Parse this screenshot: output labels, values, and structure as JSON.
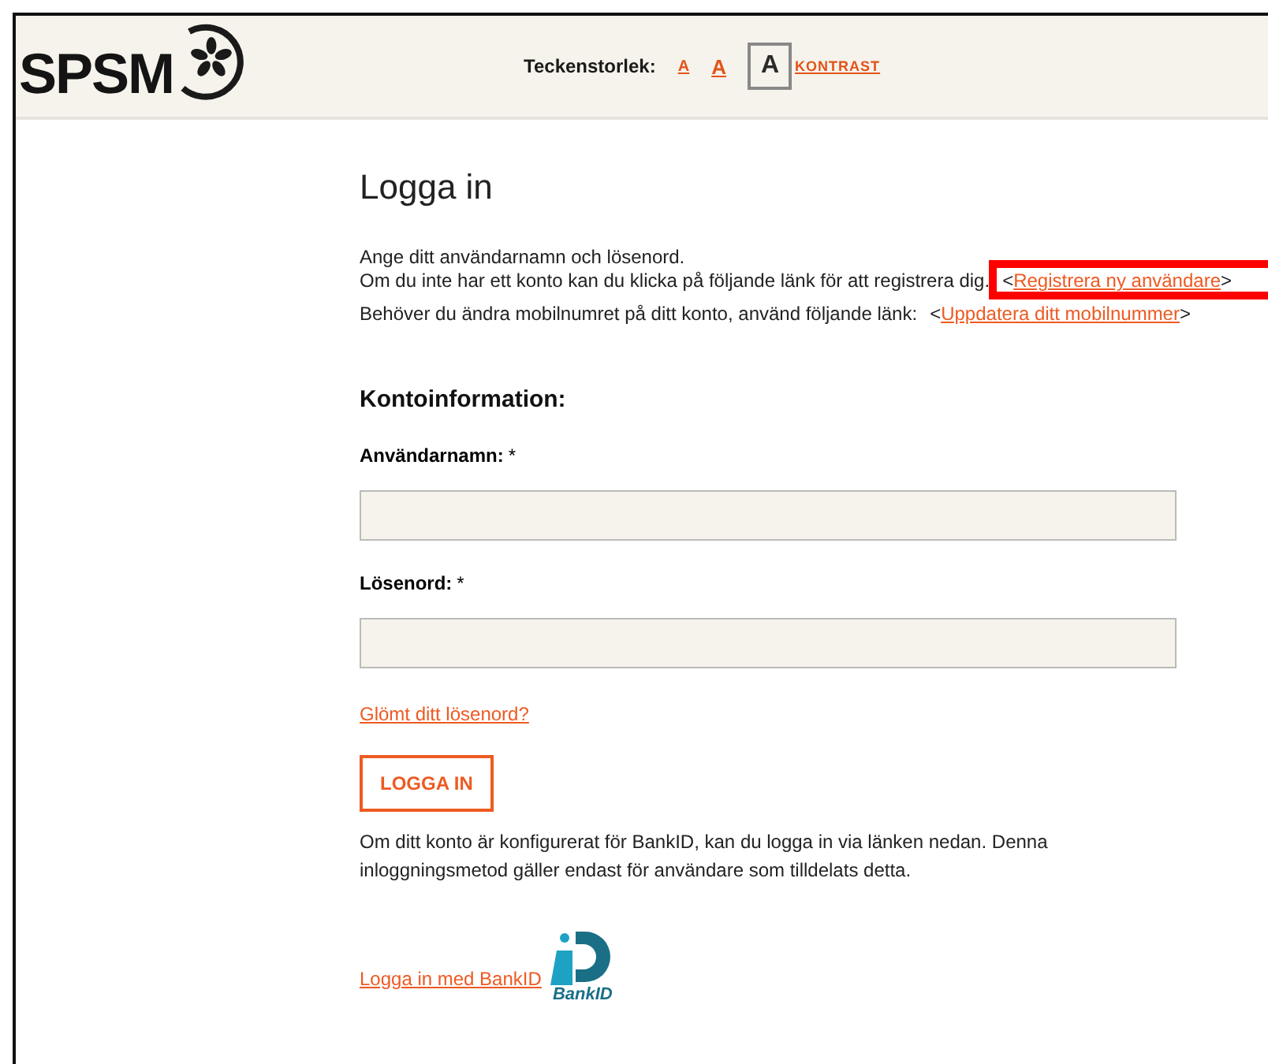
{
  "header": {
    "logo": "SPSM",
    "font_size_label": "Teckenstorlek:",
    "font_sizes": [
      {
        "label": "A",
        "kind": "small",
        "selected": false
      },
      {
        "label": "A",
        "kind": "medium",
        "selected": false
      },
      {
        "label": "A",
        "kind": "large",
        "selected": true
      }
    ],
    "contrast": "KONTRAST"
  },
  "title": "Logga in",
  "intro": [
    {
      "text": "Ange ditt användarnamn och lösenord."
    },
    {
      "text": "Om du inte har ett konto kan du klicka på följande länk för att registrera dig.",
      "open": "<",
      "link": "Registrera ny användare",
      "close": ">"
    },
    {
      "text": "Behöver du ändra mobilnumret på ditt konto, använd följande länk:",
      "open": "<",
      "link": "Uppdatera ditt mobilnummer",
      "close": ">"
    }
  ],
  "section": "Kontoinformation:",
  "fields": [
    {
      "label": "Användarnamn:",
      "required": "*"
    },
    {
      "label": "Lösenord:",
      "required": "*"
    }
  ],
  "forgot": "Glömt ditt lösenord?",
  "login_button": "LOGGA IN",
  "bankid_text": "Om ditt konto är konfigurerat för BankID, kan du logga in via länken nedan. Denna inloggningsmetod gäller endast för användare som tilldelats detta.",
  "bankid_link": "Logga in med BankID",
  "bankid_logo": "BankID"
}
